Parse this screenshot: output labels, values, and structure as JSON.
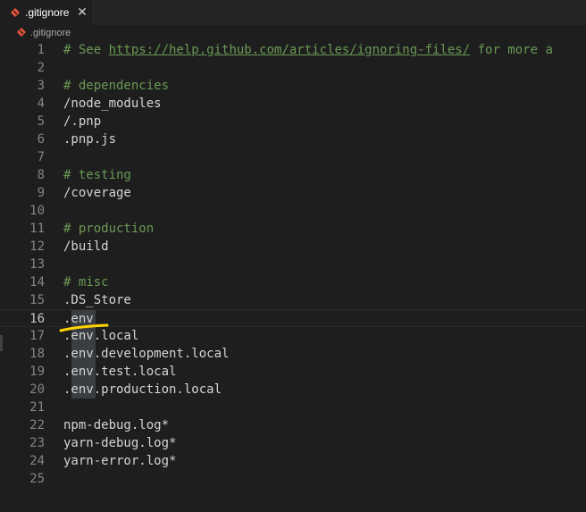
{
  "tab": {
    "label": ".gitignore",
    "close_glyph": "✕",
    "icon": "git-diamond-icon"
  },
  "breadcrumb": {
    "label": ".gitignore",
    "icon": "git-diamond-icon"
  },
  "colors": {
    "editor_bg": "#1e1e1e",
    "tabbar_bg": "#252526",
    "comment": "#6a9955",
    "text": "#d4d4d4",
    "line_number": "#858585",
    "git_icon": "#e8543b",
    "highlight": "#3a3d41",
    "annotation": "#ffd400"
  },
  "lines": [
    {
      "n": "1",
      "text": "# See https://help.github.com/articles/ignoring-files/ for more a",
      "comment": true,
      "prefix": "# See ",
      "url": "https://help.github.com/articles/ignoring-files/",
      "suffix": " for more a"
    },
    {
      "n": "2",
      "text": ""
    },
    {
      "n": "3",
      "text": "# dependencies",
      "comment": true
    },
    {
      "n": "4",
      "text": "/node_modules"
    },
    {
      "n": "5",
      "text": "/.pnp"
    },
    {
      "n": "6",
      "text": ".pnp.js"
    },
    {
      "n": "7",
      "text": ""
    },
    {
      "n": "8",
      "text": "# testing",
      "comment": true
    },
    {
      "n": "9",
      "text": "/coverage"
    },
    {
      "n": "10",
      "text": ""
    },
    {
      "n": "11",
      "text": "# production",
      "comment": true
    },
    {
      "n": "12",
      "text": "/build"
    },
    {
      "n": "13",
      "text": ""
    },
    {
      "n": "14",
      "text": "# misc",
      "comment": true
    },
    {
      "n": "15",
      "text": ".DS_Store"
    },
    {
      "n": "16",
      "text": ".env",
      "current": true,
      "highlight": true
    },
    {
      "n": "17",
      "text": ".env.local",
      "highlight": true
    },
    {
      "n": "18",
      "text": ".env.development.local",
      "highlight": true
    },
    {
      "n": "19",
      "text": ".env.test.local",
      "highlight": true
    },
    {
      "n": "20",
      "text": ".env.production.local",
      "highlight": true
    },
    {
      "n": "21",
      "text": ""
    },
    {
      "n": "22",
      "text": "npm-debug.log*"
    },
    {
      "n": "23",
      "text": "yarn-debug.log*"
    },
    {
      "n": "24",
      "text": "yarn-error.log*"
    },
    {
      "n": "25",
      "text": ""
    }
  ]
}
